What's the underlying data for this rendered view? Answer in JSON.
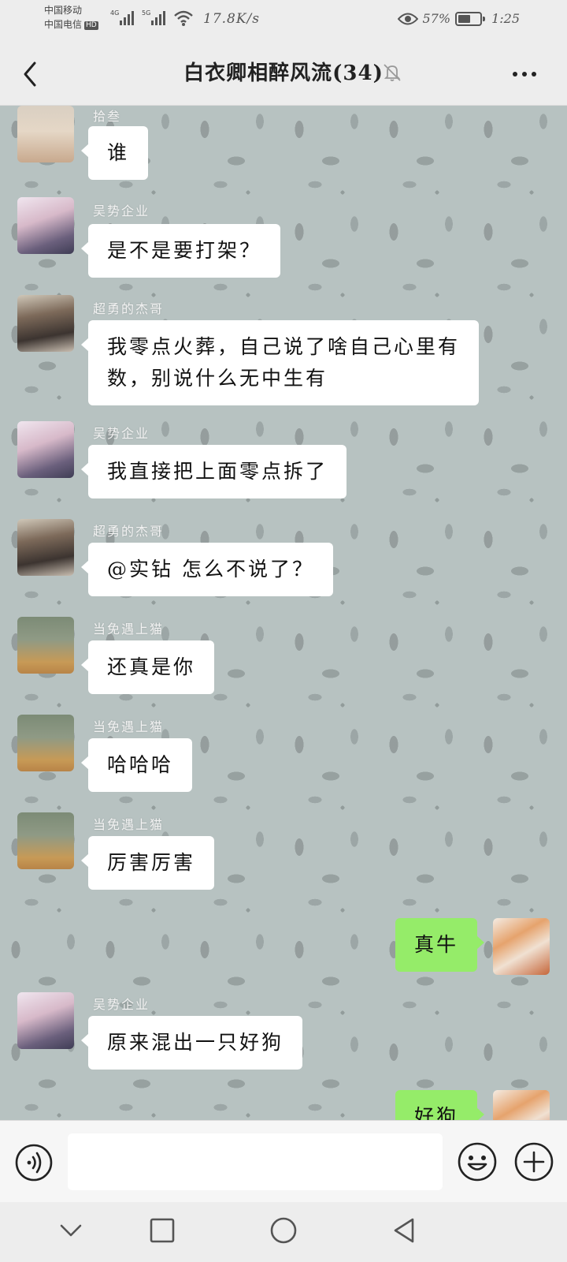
{
  "status_bar": {
    "carrier1": "中国移动",
    "carrier2": "中国电信",
    "hd": "HD",
    "net1": "4G",
    "net2": "5G",
    "speed": "17.8K/s",
    "battery": "57%",
    "battery_level": 0.57,
    "time": "1:25"
  },
  "header": {
    "title": "白衣卿相醉风流(34)",
    "back_icon": "chevron-left-icon",
    "mute_icon": "bell-off-icon",
    "more_icon": "more-dots-icon"
  },
  "messages": [
    {
      "sender": "拾叁",
      "text": "谁",
      "side": "left"
    },
    {
      "sender": "吴势企业",
      "text": "是不是要打架？",
      "side": "left"
    },
    {
      "sender": "超勇的杰哥",
      "text": "我零点火葬，自己说了啥自己心里有数，别说什么无中生有",
      "side": "left"
    },
    {
      "sender": "吴势企业",
      "text": "我直接把上面零点拆了",
      "side": "left"
    },
    {
      "sender": "超勇的杰哥",
      "text": "@实钻 怎么不说了？",
      "side": "left"
    },
    {
      "sender": "当免遇上猫",
      "text": "还真是你",
      "side": "left"
    },
    {
      "sender": "当免遇上猫",
      "text": "哈哈哈",
      "side": "left"
    },
    {
      "sender": "当免遇上猫",
      "text": "厉害厉害",
      "side": "left"
    },
    {
      "sender": "",
      "text": "真牛",
      "side": "right"
    },
    {
      "sender": "吴势企业",
      "text": "原来混出一只好狗",
      "side": "left"
    },
    {
      "sender": "",
      "text": "好狗",
      "side": "right"
    }
  ],
  "input": {
    "value": "",
    "voice_icon": "voice-icon",
    "emoji_icon": "emoji-icon",
    "plus_icon": "plus-icon"
  },
  "nav": {
    "icons": [
      "chevron-down-icon",
      "square-icon",
      "circle-icon",
      "triangle-back-icon"
    ]
  },
  "colors": {
    "bubble_self": "#95ec69",
    "bubble_other": "#ffffff",
    "chat_background": "#b7c2c1",
    "bar_background": "#ededed"
  }
}
